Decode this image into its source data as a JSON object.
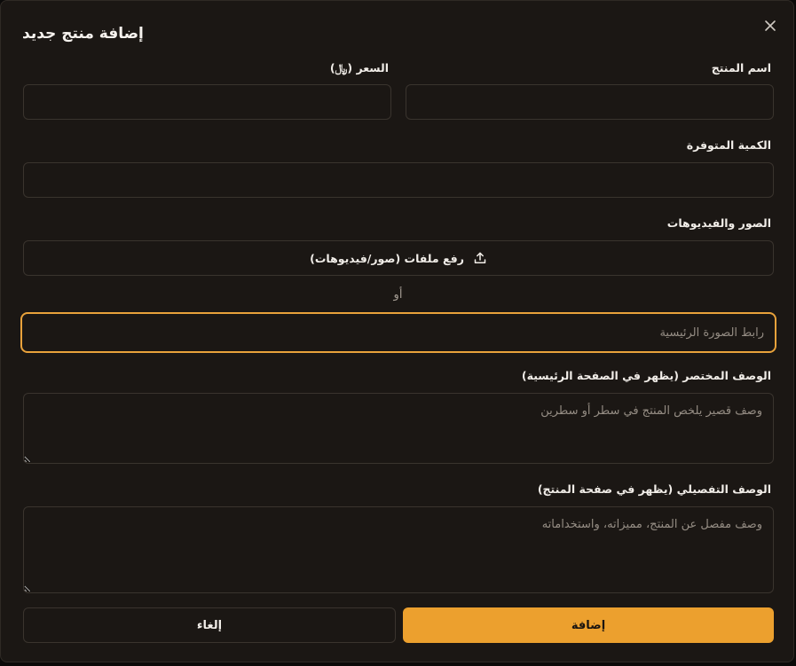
{
  "dialog": {
    "title": "إضافة منتج جديد",
    "close_icon": "close-icon"
  },
  "form": {
    "product_name": {
      "label": "اسم المنتج",
      "value": "",
      "placeholder": ""
    },
    "price": {
      "label": "السعر (﷼)",
      "value": "",
      "placeholder": ""
    },
    "quantity": {
      "label": "الكمية المتوفرة",
      "value": "",
      "placeholder": ""
    },
    "media": {
      "label": "الصور والفيديوهات",
      "upload_label": "رفع ملفات (صور/فيديوهات)",
      "upload_icon": "upload-icon",
      "or_text": "أو",
      "url_placeholder": "رابط الصورة الرئيسية"
    },
    "short_description": {
      "label": "الوصف المختصر (يظهر في الصفحة الرئيسية)",
      "placeholder": "وصف قصير يلخص المنتج في سطر أو سطرين"
    },
    "long_description": {
      "label": "الوصف التفصيلي (يظهر في صفحة المنتج)",
      "placeholder": "وصف مفصل عن المنتج، مميزاته، واستخداماته"
    }
  },
  "actions": {
    "submit_label": "إضافة",
    "cancel_label": "إلغاء"
  },
  "colors": {
    "accent": "#eca02e",
    "background": "#1b1714",
    "border": "#3a342e"
  }
}
